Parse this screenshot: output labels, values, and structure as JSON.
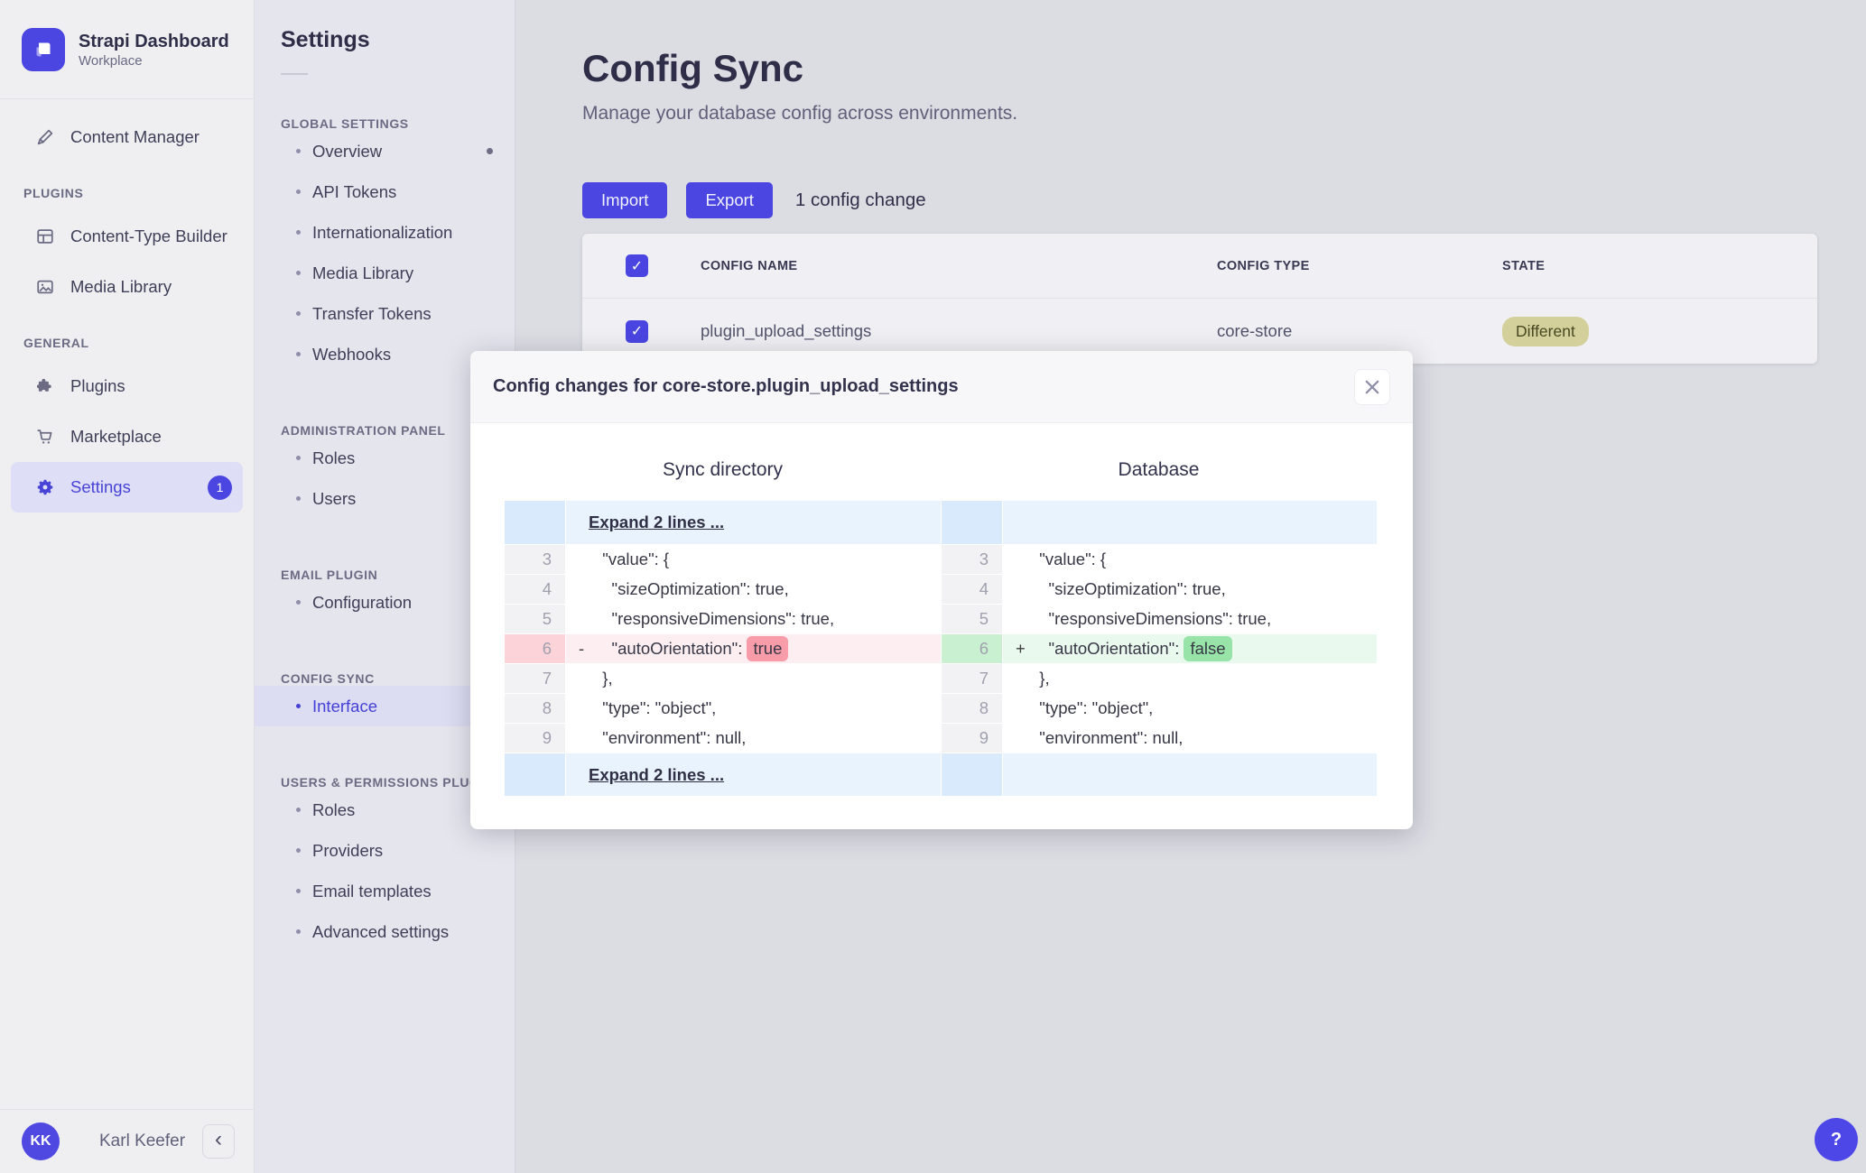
{
  "brand": {
    "title": "Strapi Dashboard",
    "subtitle": "Workplace"
  },
  "nav": {
    "sections": [
      {
        "label": "",
        "items": [
          {
            "icon": "content-manager-icon",
            "label": "Content Manager"
          }
        ]
      },
      {
        "label": "PLUGINS",
        "items": [
          {
            "icon": "content-type-builder-icon",
            "label": "Content-Type Builder"
          },
          {
            "icon": "media-library-icon",
            "label": "Media Library"
          }
        ]
      },
      {
        "label": "GENERAL",
        "items": [
          {
            "icon": "plugins-icon",
            "label": "Plugins"
          },
          {
            "icon": "marketplace-icon",
            "label": "Marketplace"
          },
          {
            "icon": "settings-gear-icon",
            "label": "Settings",
            "active": true,
            "badge": "1"
          }
        ]
      }
    ],
    "footer": {
      "avatar_initials": "KK",
      "user_name": "Karl Keefer",
      "collapse_icon": "‹"
    }
  },
  "subnav": {
    "title": "Settings",
    "sections": [
      {
        "label": "GLOBAL SETTINGS",
        "items": [
          {
            "label": "Overview",
            "dot": true
          },
          {
            "label": "API Tokens"
          },
          {
            "label": "Internationalization"
          },
          {
            "label": "Media Library"
          },
          {
            "label": "Transfer Tokens"
          },
          {
            "label": "Webhooks"
          }
        ]
      },
      {
        "label": "ADMINISTRATION PANEL",
        "items": [
          {
            "label": "Roles"
          },
          {
            "label": "Users"
          }
        ]
      },
      {
        "label": "EMAIL PLUGIN",
        "items": [
          {
            "label": "Configuration"
          }
        ]
      },
      {
        "label": "CONFIG SYNC",
        "items": [
          {
            "label": "Interface",
            "active": true
          }
        ]
      },
      {
        "label": "USERS & PERMISSIONS PLUGIN",
        "items": [
          {
            "label": "Roles"
          },
          {
            "label": "Providers"
          },
          {
            "label": "Email templates"
          },
          {
            "label": "Advanced settings"
          }
        ]
      }
    ]
  },
  "page": {
    "title": "Config Sync",
    "subtitle": "Manage your database config across environments.",
    "import_label": "Import",
    "export_label": "Export",
    "change_summary": "1 config change"
  },
  "table": {
    "headers": [
      "CONFIG NAME",
      "CONFIG TYPE",
      "STATE"
    ],
    "rows": [
      {
        "config_name": "plugin_upload_settings",
        "config_type": "core-store",
        "state": "Different"
      }
    ]
  },
  "modal": {
    "title": "Config changes for core-store.plugin_upload_settings",
    "left_title": "Sync directory",
    "right_title": "Database",
    "expand_label": "Expand 2 lines ...",
    "left_lines": [
      {
        "num": 3,
        "type": "context",
        "text": "  \"value\": {"
      },
      {
        "num": 4,
        "type": "context",
        "text": "    \"sizeOptimization\": true,"
      },
      {
        "num": 5,
        "type": "context",
        "text": "    \"responsiveDimensions\": true,"
      },
      {
        "num": 6,
        "type": "del",
        "marker": "-",
        "pre": "    \"autoOrientation\": ",
        "hl": "true"
      },
      {
        "num": 7,
        "type": "context",
        "text": "  },"
      },
      {
        "num": 8,
        "type": "context",
        "text": "  \"type\": \"object\","
      },
      {
        "num": 9,
        "type": "context",
        "text": "  \"environment\": null,"
      }
    ],
    "right_lines": [
      {
        "num": 3,
        "type": "context",
        "text": "  \"value\": {"
      },
      {
        "num": 4,
        "type": "context",
        "text": "    \"sizeOptimization\": true,"
      },
      {
        "num": 5,
        "type": "context",
        "text": "    \"responsiveDimensions\": true,"
      },
      {
        "num": 6,
        "type": "add",
        "marker": "+",
        "pre": "    \"autoOrientation\": ",
        "hl": "false"
      },
      {
        "num": 7,
        "type": "context",
        "text": "  },"
      },
      {
        "num": 8,
        "type": "context",
        "text": "  \"type\": \"object\","
      },
      {
        "num": 9,
        "type": "context",
        "text": "  \"environment\": null,"
      }
    ]
  },
  "help_button": {
    "label": "?"
  },
  "colors": {
    "accent": "#4945ff",
    "expand_row": "#e9f3fd",
    "expand_gutter": "#d9eafc",
    "del_row": "#fdeef1",
    "del_gutter": "#fcd3d9",
    "del_word": "#f79ca8",
    "add_row": "#e9f9ee",
    "add_gutter": "#c9f1d1",
    "add_word": "#97e3a8",
    "state_badge_bg": "#d3d09b",
    "state_badge_text": "#474721"
  }
}
